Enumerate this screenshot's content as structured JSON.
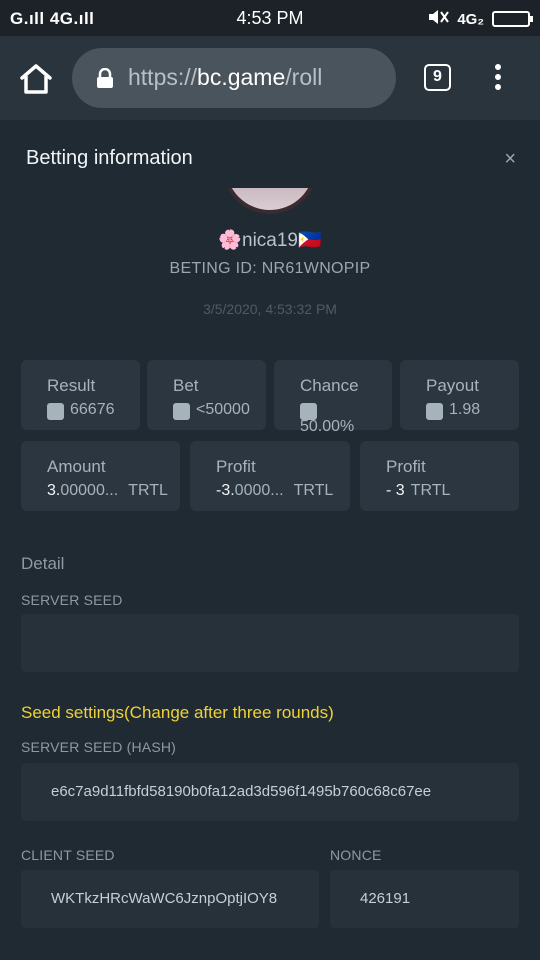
{
  "status_bar": {
    "signal_left": "G.ıll 4G.ıll",
    "time": "4:53 PM",
    "network": "4G₂"
  },
  "browser": {
    "url_scheme": "https://",
    "url_domain": "bc.game",
    "url_path": "/roll",
    "tab_count": "9"
  },
  "modal": {
    "title": "Betting information",
    "close_label": "×",
    "username": "🌸nica19🇵🇭",
    "bet_id": "BETING ID: NR61WNOPIP",
    "timestamp": "3/5/2020, 4:53:32 PM",
    "stats_row1": [
      {
        "label": "Result",
        "value": "66676",
        "icon": "result-icon"
      },
      {
        "label": "Bet",
        "value": "<50000",
        "icon": "dice-icon"
      },
      {
        "label": "Chance",
        "value": "50.00%",
        "icon": "chance-icon"
      },
      {
        "label": "Payout",
        "value": "1.98",
        "icon": "payout-icon"
      }
    ],
    "stats_row2": [
      {
        "label": "Amount",
        "value_main": "3.",
        "value_rest": "00000...",
        "unit": "TRTL"
      },
      {
        "label": "Profit",
        "value_main": "-3.",
        "value_rest": "0000...",
        "unit": "TRTL"
      },
      {
        "label": "Profit",
        "value_main": "- 3",
        "value_rest": "",
        "unit": "TRTL"
      }
    ],
    "detail_label": "Detail",
    "server_seed_label": "SERVER SEED",
    "server_seed_value": "",
    "seed_settings_note": "Seed settings(Change after three rounds)",
    "server_seed_hash_label": "SERVER SEED (HASH)",
    "server_seed_hash_value": "e6c7a9d11fbfd58190b0fa12ad3d596f1495b760c68c67ee",
    "client_seed_label": "CLIENT SEED",
    "client_seed_value": "WKTkzHRcWaWC6JznpOptjIOY8",
    "nonce_label": "NONCE",
    "nonce_value": "426191"
  },
  "colors": {
    "background": "#1f2a33",
    "card": "#2b3640",
    "accent_yellow": "#f0d237"
  }
}
